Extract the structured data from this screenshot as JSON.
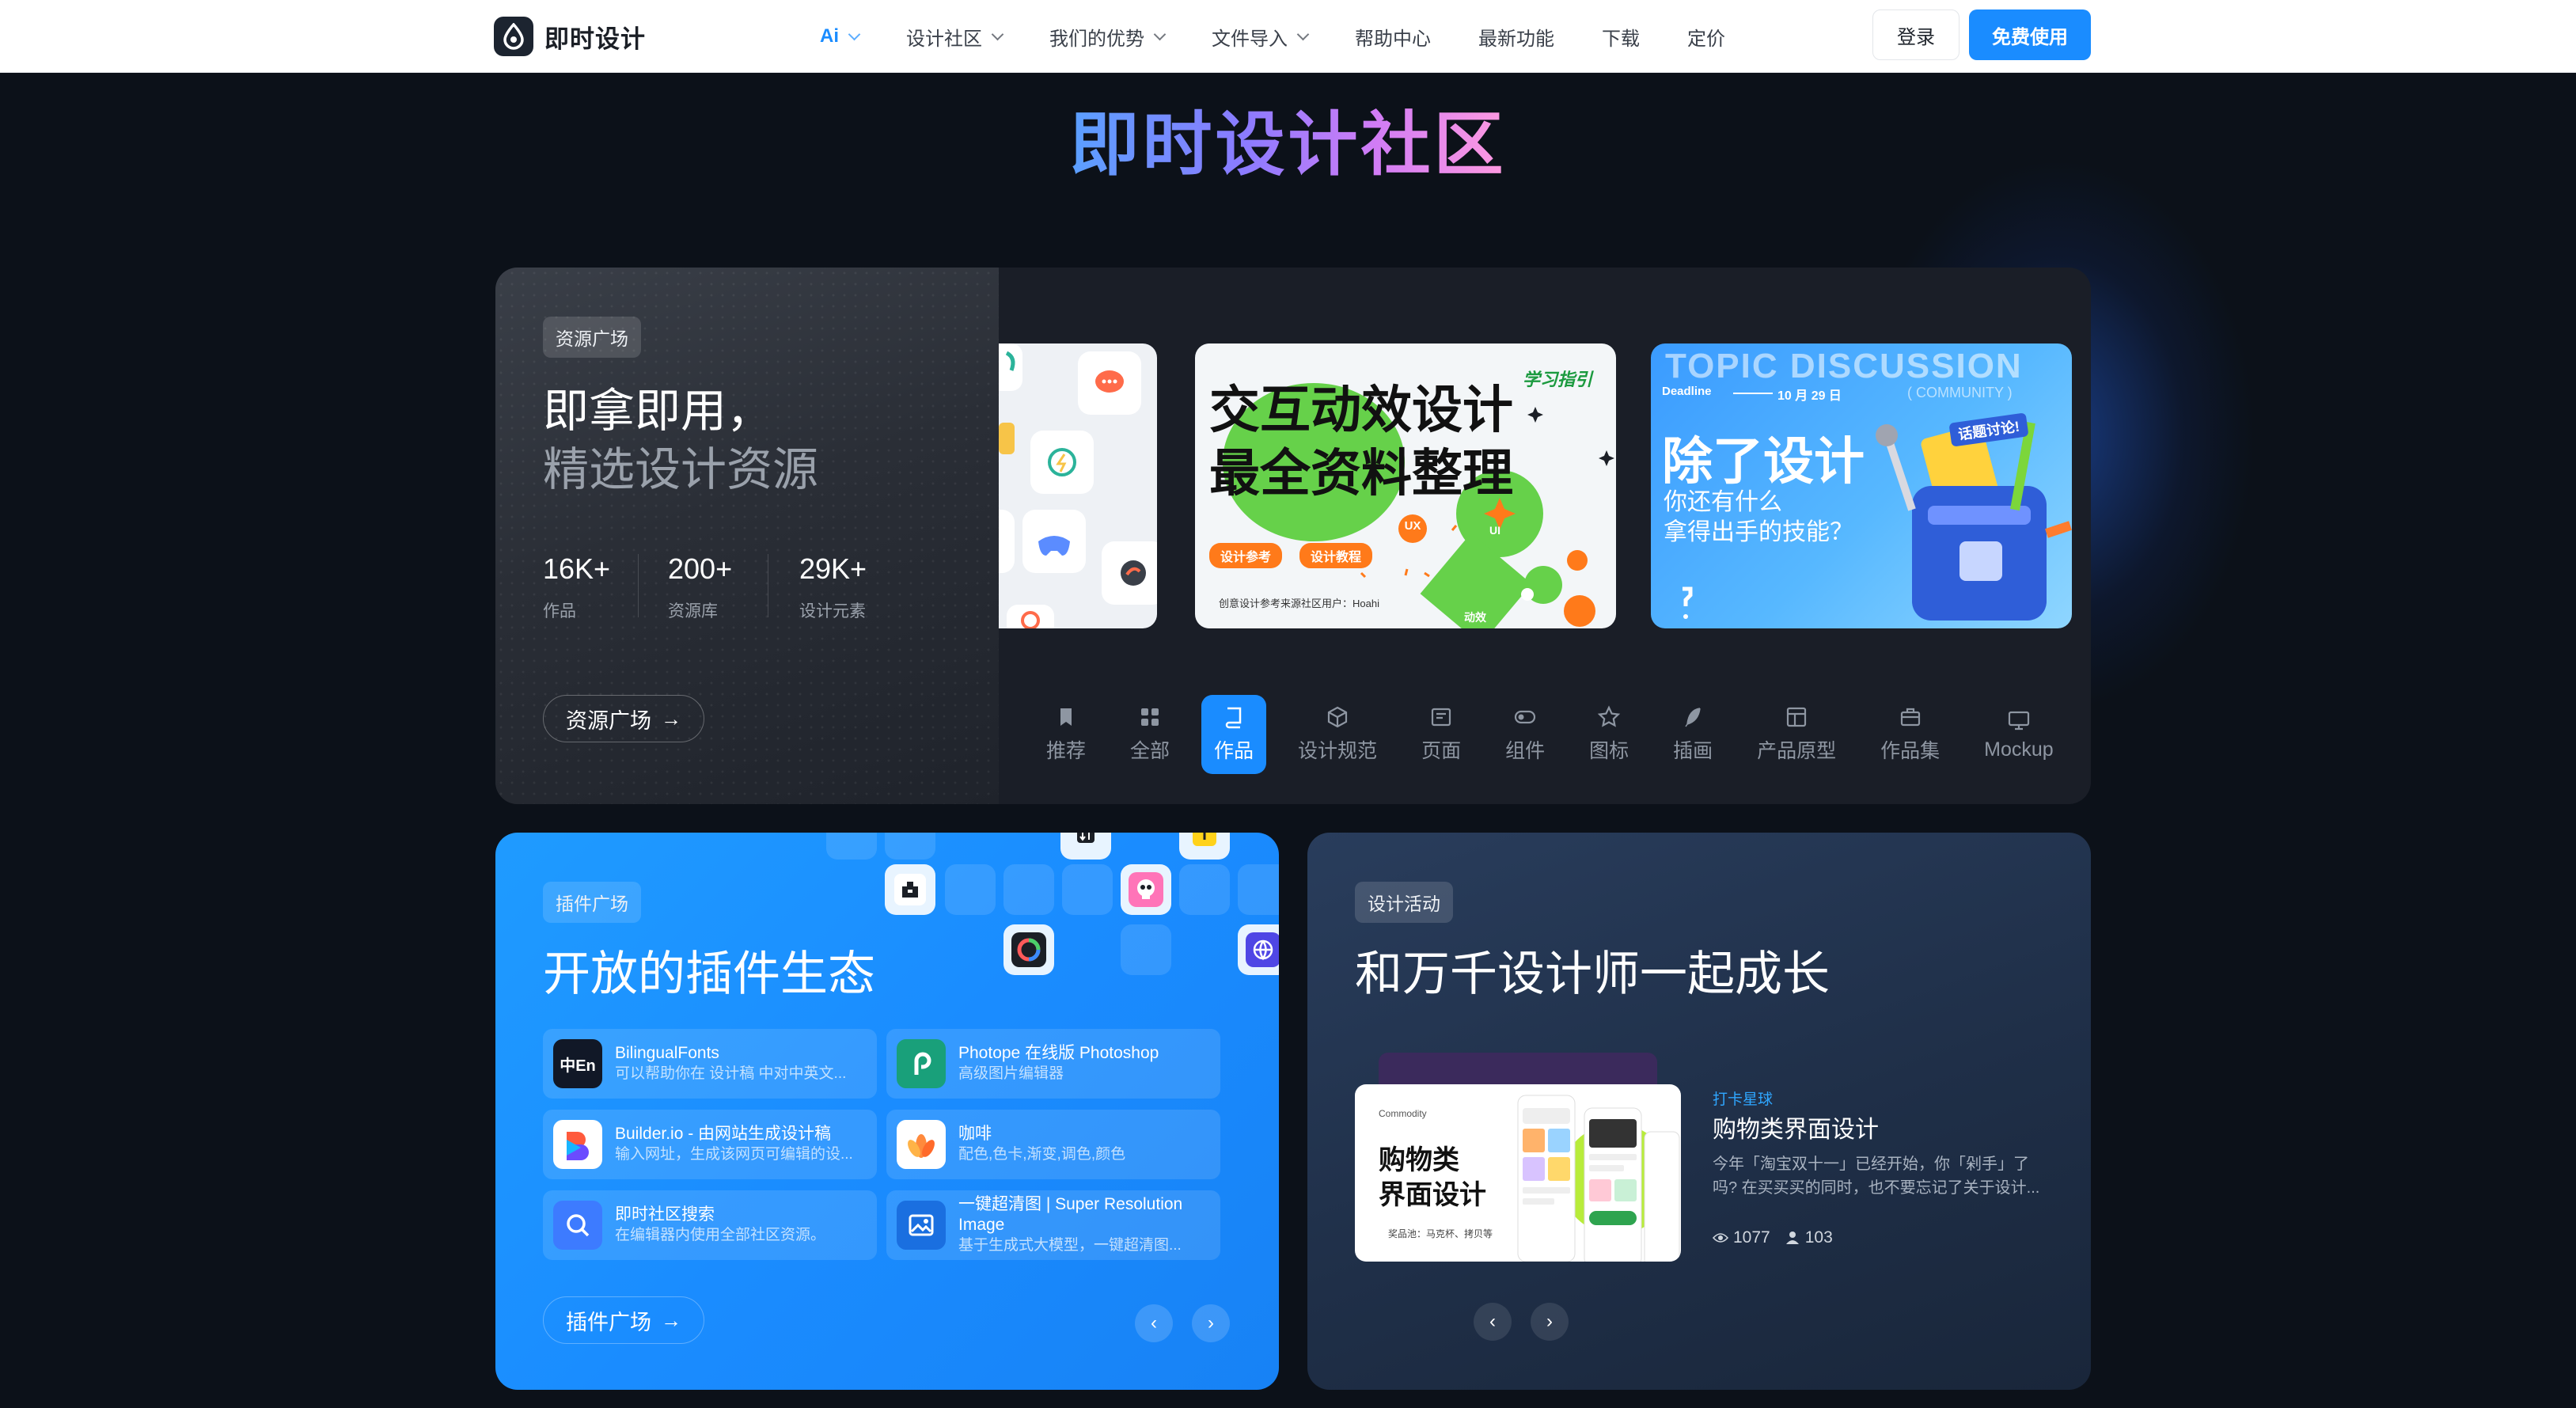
{
  "nav": {
    "logo": "即时设计",
    "menu": [
      {
        "label": "Ai",
        "caret": true,
        "active": true
      },
      {
        "label": "设计社区",
        "caret": true
      },
      {
        "label": "我们的优势",
        "caret": true
      },
      {
        "label": "文件导入",
        "caret": true
      },
      {
        "label": "帮助中心",
        "caret": false
      },
      {
        "label": "最新功能",
        "caret": false
      },
      {
        "label": "下载",
        "caret": false
      },
      {
        "label": "定价",
        "caret": false
      }
    ],
    "login": "登录",
    "free": "免费使用"
  },
  "title": "即时设计社区",
  "resource": {
    "tag": "资源广场",
    "headline1": "即拿即用，",
    "headline2": "精选设计资源",
    "stats": [
      {
        "num": "16K+",
        "label": "作品"
      },
      {
        "num": "200+",
        "label": "资源库"
      },
      {
        "num": "29K+",
        "label": "设计元素"
      }
    ],
    "button": "资源广场",
    "card_b": {
      "tag": "学习指引",
      "line1": "交互动效设计",
      "line2": "最全资料整理",
      "chip1": "设计参考",
      "chip2": "设计教程",
      "foot": "创意设计参考来源社区用户：Hoahi",
      "label1": "UX",
      "label2": "UI",
      "label3": "动效"
    },
    "card_c": {
      "banner": "TOPIC DISCUSSION",
      "community": "( COMMUNITY )",
      "deadline": "Deadline",
      "date": "10 月 29 日",
      "headline": "除了设计",
      "sub1": "你还有什么",
      "sub2": "拿得出手的技能？",
      "badge": "话题讨论!"
    },
    "tabs": [
      {
        "label": "推荐",
        "icon": "bookmark-icon"
      },
      {
        "label": "全部",
        "icon": "grid-icon"
      },
      {
        "label": "作品",
        "icon": "book-icon",
        "active": true
      },
      {
        "label": "设计规范",
        "icon": "cube-icon"
      },
      {
        "label": "页面",
        "icon": "page-icon"
      },
      {
        "label": "组件",
        "icon": "toggle-icon"
      },
      {
        "label": "图标",
        "icon": "star-icon"
      },
      {
        "label": "插画",
        "icon": "feather-icon"
      },
      {
        "label": "产品原型",
        "icon": "layout-icon"
      },
      {
        "label": "作品集",
        "icon": "briefcase-icon"
      },
      {
        "label": "Mockup",
        "icon": "monitor-icon"
      }
    ]
  },
  "plugins": {
    "tag": "插件广场",
    "headline": "开放的插件生态",
    "items": [
      {
        "name": "BilingualFonts",
        "desc": "可以帮助你在 设计稿 中对中英文...",
        "icon": "bilingual-fonts-icon",
        "bg": "#111827"
      },
      {
        "name": "Photope 在线版 Photoshop",
        "desc": "高级图片编辑器",
        "icon": "photopea-icon",
        "bg": "#19a07a"
      },
      {
        "name": "Builder.io - 由网站生成设计稿",
        "desc": "输入网址，生成该网页可编辑的设...",
        "icon": "builder-io-icon",
        "bg": "#ffffff"
      },
      {
        "name": "咖啡",
        "desc": "配色,色卡,渐变,调色,颜色",
        "icon": "palette-flower-icon",
        "bg": "#ffffff"
      },
      {
        "name": "即时社区搜索",
        "desc": "在编辑器内使用全部社区资源。",
        "icon": "search-icon",
        "bg": "#3d7bff"
      },
      {
        "name": "一键超清图 | Super Resolution Image",
        "desc": "基于生成式大模型，一键超清图...",
        "icon": "image-icon",
        "bg": "#1a6fe0"
      }
    ],
    "button": "插件广场"
  },
  "events": {
    "tag": "设计活动",
    "headline": "和万千设计师一起成长",
    "card": {
      "small": "Commodity",
      "title1": "购物类",
      "title2": "界面设计",
      "foot": "奖品池：马克杯、拷贝等"
    },
    "event_tag": "打卡星球",
    "event_title": "购物类界面设计",
    "event_desc": "今年「淘宝双十一」已经开始，你「剁手」了吗? 在买买买的同时，也不要忘记了关于设计...",
    "views": "1077",
    "users": "103"
  },
  "colors": {
    "accent": "#1a8cff",
    "background": "#0c1119"
  }
}
